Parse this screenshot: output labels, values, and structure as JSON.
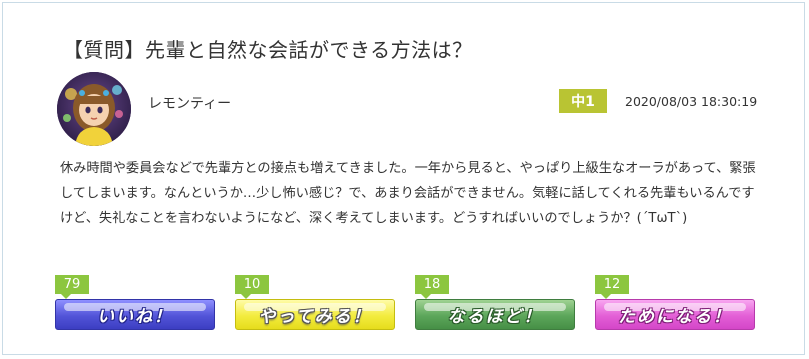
{
  "post": {
    "title": "【質問】先輩と自然な会話ができる方法は？",
    "author": "レモンティー",
    "grade": "中1",
    "date": "2020/08/03 18:30:19",
    "body": "休み時間や委員会などで先輩方との接点も増えてきました。一年から見ると、やっぱり上級生なオーラがあって、緊張してしまいます。なんというか…少し怖い感じ？で、あまり会話ができません。気軽に話してくれる先輩もいるんですけど、失礼なことを言わないようになど、深く考えてしまいます。どうすればいいのでしょうか？(´TωT`)"
  },
  "reactions": [
    {
      "label": "いいね！",
      "count": "79",
      "color": "#5254d8"
    },
    {
      "label": "やってみる！",
      "count": "10",
      "color": "#f3ec3e"
    },
    {
      "label": "なるほど！",
      "count": "18",
      "color": "#5ca65a"
    },
    {
      "label": "ためになる！",
      "count": "12",
      "color": "#e35fd6"
    }
  ]
}
